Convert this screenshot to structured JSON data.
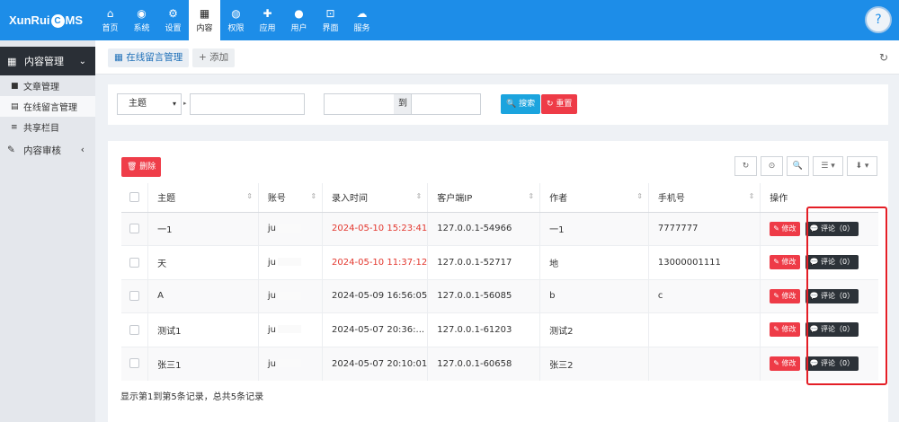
{
  "brand": {
    "logo_text_a": "XunRui",
    "logo_c": "C",
    "logo_text_b": "MS"
  },
  "nav": [
    {
      "icon": "⌂",
      "label": "首页",
      "icon_name": "home-icon"
    },
    {
      "icon": "◉",
      "label": "系统",
      "icon_name": "globe-icon"
    },
    {
      "icon": "⚙",
      "label": "设置",
      "icon_name": "gears-icon"
    },
    {
      "icon": "▦",
      "label": "内容",
      "icon_name": "grid-icon",
      "active": true
    },
    {
      "icon": "◍",
      "label": "权限",
      "icon_name": "user-circle-icon"
    },
    {
      "icon": "✚",
      "label": "应用",
      "icon_name": "puzzle-icon"
    },
    {
      "icon": "●",
      "label": "用户",
      "icon_name": "user-icon"
    },
    {
      "icon": "⊡",
      "label": "界面",
      "icon_name": "html5-icon"
    },
    {
      "icon": "☁",
      "label": "服务",
      "icon_name": "cloud-icon"
    }
  ],
  "avatar_text": "?",
  "sidebar": {
    "head": {
      "icon": "▦",
      "label": "内容管理",
      "chevron": "⌄"
    },
    "items": [
      {
        "icon": "■",
        "label": "文章管理"
      },
      {
        "icon": "▤",
        "label": "在线留言管理"
      },
      {
        "icon": "≡",
        "label": "共享栏目"
      }
    ],
    "group": {
      "icon": "✎",
      "label": "内容审核",
      "chevron": "‹"
    }
  },
  "tabs": {
    "active": "▦ 在线留言管理",
    "add": "+ 添加",
    "refresh_icon": "↻"
  },
  "filter": {
    "field_select": "主题",
    "to_label": "到",
    "search_btn": "🔍 搜索",
    "reset_btn": "↻ 重置"
  },
  "toolbar": {
    "delete_btn": "🗑 删除",
    "tools": [
      "↻",
      "⊙",
      "🔍",
      "☰ ▾",
      "⬇ ▾"
    ]
  },
  "table": {
    "headers": [
      "",
      "主题",
      "账号",
      "录入时间",
      "客户端IP",
      "作者",
      "手机号",
      "操作"
    ],
    "rows": [
      {
        "subject": "一1",
        "account": "ju",
        "time": "2024-05-10 15:23:41",
        "time_red": true,
        "ip": "127.0.0.1-54966",
        "author": "一1",
        "phone": "7777777"
      },
      {
        "subject": "天",
        "account": "ju",
        "time": "2024-05-10 11:37:12",
        "time_red": true,
        "ip": "127.0.0.1-52717",
        "author": "地",
        "phone": "13000001111"
      },
      {
        "subject": "A",
        "account": "ju",
        "time": "2024-05-09 16:56:05",
        "time_red": false,
        "ip": "127.0.0.1-56085",
        "author": "b",
        "phone": "c"
      },
      {
        "subject": "测试1",
        "account": "ju",
        "time": "2024-05-07 20:36:...",
        "time_red": false,
        "ip": "127.0.0.1-61203",
        "author": "测试2",
        "phone": ""
      },
      {
        "subject": "张三1",
        "account": "ju",
        "time": "2024-05-07 20:10:01",
        "time_red": false,
        "ip": "127.0.0.1-60658",
        "author": "张三2",
        "phone": ""
      }
    ],
    "edit_label": "✎ 修改",
    "comment_label": "💬 评论（0）"
  },
  "footer": "显示第1到第5条记录，总共5条记录",
  "colors": {
    "accent": "#1d8de8",
    "danger": "#ee3b47",
    "highlight": "#e41e26"
  }
}
